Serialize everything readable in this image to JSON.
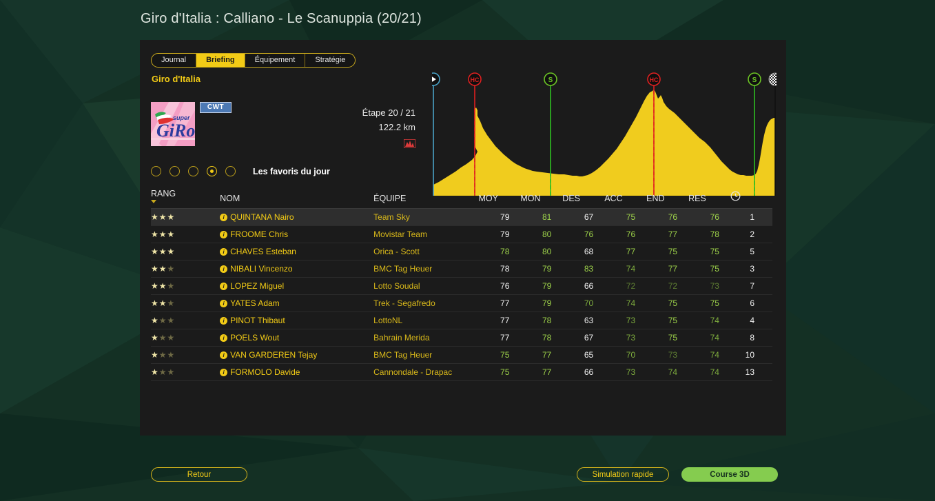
{
  "page_title": "Giro d'Italia : Calliano - Le Scanuppia (20/21)",
  "tabs": [
    {
      "label": "Journal",
      "active": false
    },
    {
      "label": "Briefing",
      "active": true
    },
    {
      "label": "Équipement",
      "active": false
    },
    {
      "label": "Stratégie",
      "active": false
    }
  ],
  "race": {
    "name": "Giro d'Italia",
    "logo_text_main": "GiRo",
    "logo_text_super": "super",
    "badge": "CWT"
  },
  "stage": {
    "label": "Étape 20 / 21",
    "distance": "122.2 km",
    "terrain_icon": "mountain-icon"
  },
  "profile": {
    "markers": [
      {
        "type": "start",
        "icon": "play-icon",
        "label": "",
        "x_pct": 0.4,
        "color": "#4aa3c8"
      },
      {
        "type": "climb",
        "icon": "climb-marker-icon",
        "label": "HC",
        "x_pct": 12.5,
        "color": "#e02020"
      },
      {
        "type": "sprint",
        "icon": "sprint-marker-icon",
        "label": "S",
        "x_pct": 34.5,
        "color": "#3ac72e"
      },
      {
        "type": "climb",
        "icon": "climb-marker-icon",
        "label": "HC",
        "x_pct": 53.7,
        "color": "#e02020"
      },
      {
        "type": "sprint",
        "icon": "sprint-marker-icon",
        "label": "S",
        "x_pct": 79.4,
        "color": "#3ac72e"
      },
      {
        "type": "finish",
        "icon": "checkered-flag-icon",
        "label": "",
        "x_pct": 99.6,
        "color": "#cccccc"
      }
    ],
    "fill_color": "#f0cc1e"
  },
  "view_options": {
    "radios": [
      false,
      false,
      false,
      true,
      false
    ],
    "label": "Les favoris du jour"
  },
  "table": {
    "headers": [
      "RANG",
      "NOM",
      "ÉQUIPE",
      "MOY",
      "MON",
      "DES",
      "ACC",
      "END",
      "RES",
      "clock-icon"
    ],
    "rows": [
      {
        "stars": 3,
        "name": "QUINTANA Nairo",
        "team": "Team Sky",
        "moy": 79,
        "moy_c": "white",
        "mon": 81,
        "mon_c": "hi",
        "des": 67,
        "des_c": "white",
        "acc": 75,
        "acc_c": "hi",
        "end": 76,
        "end_c": "hi",
        "res": 76,
        "res_c": "hi",
        "time": 1
      },
      {
        "stars": 3,
        "name": "FROOME Chris",
        "team": "Movistar Team",
        "moy": 79,
        "moy_c": "white",
        "mon": 80,
        "mon_c": "hi",
        "des": 76,
        "des_c": "hi",
        "acc": 76,
        "acc_c": "hi",
        "end": 77,
        "end_c": "hi",
        "res": 78,
        "res_c": "hi",
        "time": 2
      },
      {
        "stars": 3,
        "name": "CHAVES Esteban",
        "team": "Orica - Scott",
        "moy": 78,
        "moy_c": "hi",
        "mon": 80,
        "mon_c": "hi",
        "des": 68,
        "des_c": "white",
        "acc": 77,
        "acc_c": "hi",
        "end": 75,
        "end_c": "hi",
        "res": 75,
        "res_c": "hi",
        "time": 5
      },
      {
        "stars": 2,
        "name": "NIBALI Vincenzo",
        "team": "BMC Tag Heuer",
        "moy": 78,
        "moy_c": "white",
        "mon": 79,
        "mon_c": "hi",
        "des": 83,
        "des_c": "hi",
        "acc": 74,
        "acc_c": "mid",
        "end": 77,
        "end_c": "hi",
        "res": 75,
        "res_c": "hi",
        "time": 3
      },
      {
        "stars": 2,
        "name": "LOPEZ Miguel",
        "team": "Lotto Soudal",
        "moy": 76,
        "moy_c": "white",
        "mon": 79,
        "mon_c": "hi",
        "des": 66,
        "des_c": "white",
        "acc": 72,
        "acc_c": "lo",
        "end": 72,
        "end_c": "lo",
        "res": 73,
        "res_c": "lo",
        "time": 7
      },
      {
        "stars": 2,
        "name": "YATES Adam",
        "team": "Trek - Segafredo",
        "moy": 77,
        "moy_c": "white",
        "mon": 79,
        "mon_c": "hi",
        "des": 70,
        "des_c": "mid",
        "acc": 74,
        "acc_c": "mid",
        "end": 75,
        "end_c": "hi",
        "res": 75,
        "res_c": "hi",
        "time": 6
      },
      {
        "stars": 1,
        "name": "PINOT Thibaut",
        "team": "LottoNL",
        "moy": 77,
        "moy_c": "white",
        "mon": 78,
        "mon_c": "hi",
        "des": 63,
        "des_c": "white",
        "acc": 73,
        "acc_c": "mid",
        "end": 75,
        "end_c": "hi",
        "res": 74,
        "res_c": "mid",
        "time": 4
      },
      {
        "stars": 1,
        "name": "POELS Wout",
        "team": "Bahrain Merida",
        "moy": 77,
        "moy_c": "white",
        "mon": 78,
        "mon_c": "hi",
        "des": 67,
        "des_c": "white",
        "acc": 73,
        "acc_c": "mid",
        "end": 75,
        "end_c": "hi",
        "res": 74,
        "res_c": "mid",
        "time": 8
      },
      {
        "stars": 1,
        "name": "VAN GARDEREN Tejay",
        "team": "BMC Tag Heuer",
        "moy": 75,
        "moy_c": "hi",
        "mon": 77,
        "mon_c": "hi",
        "des": 65,
        "des_c": "white",
        "acc": 70,
        "acc_c": "mid",
        "end": 73,
        "end_c": "lo",
        "res": 74,
        "res_c": "mid",
        "time": 10
      },
      {
        "stars": 1,
        "name": "FORMOLO Davide",
        "team": "Cannondale - Drapac",
        "moy": 75,
        "moy_c": "hi",
        "mon": 77,
        "mon_c": "hi",
        "des": 66,
        "des_c": "white",
        "acc": 73,
        "acc_c": "mid",
        "end": 74,
        "end_c": "mid",
        "res": 74,
        "res_c": "mid",
        "time": 13
      }
    ]
  },
  "buttons": {
    "back": "Retour",
    "quick_sim": "Simulation rapide",
    "race_3d": "Course 3D"
  },
  "colors": {
    "accent_yellow": "#f2cb16",
    "panel_bg": "#1b1b1b",
    "page_bg": "#143024",
    "primary_green": "#85cc4f",
    "profile_fill": "#f0cc1e"
  }
}
